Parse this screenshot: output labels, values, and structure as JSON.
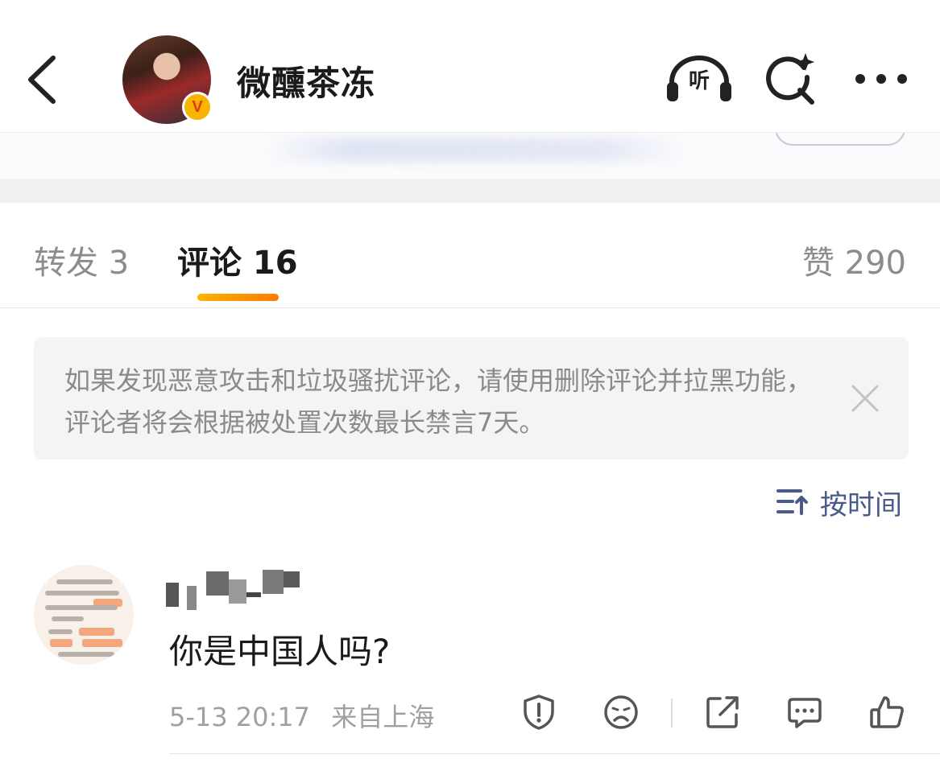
{
  "header": {
    "username": "微醺茶冻",
    "verified_badge": "V",
    "listen_label": "听",
    "icons": [
      "back-arrow-icon",
      "headphones-icon",
      "ai-search-icon",
      "more-icon"
    ]
  },
  "tabs": {
    "repost": "转发 3",
    "comment": "评论 16",
    "like": "赞 290",
    "active": "comment",
    "accent": "#ff8a00"
  },
  "notice": {
    "text": "如果发现恶意攻击和垃圾骚扰评论，请使用删除评论并拉黑功能，评论者将会根据被处置次数最长禁言7天。"
  },
  "sort": {
    "label": "按时间",
    "color": "#4a5a8a"
  },
  "comment": {
    "text": "你是中国人吗?",
    "time": "5-13 20:17",
    "location": "来自上海",
    "actions": [
      "report-icon",
      "dislike-face-icon",
      "share-icon",
      "reply-icon",
      "like-icon"
    ]
  }
}
